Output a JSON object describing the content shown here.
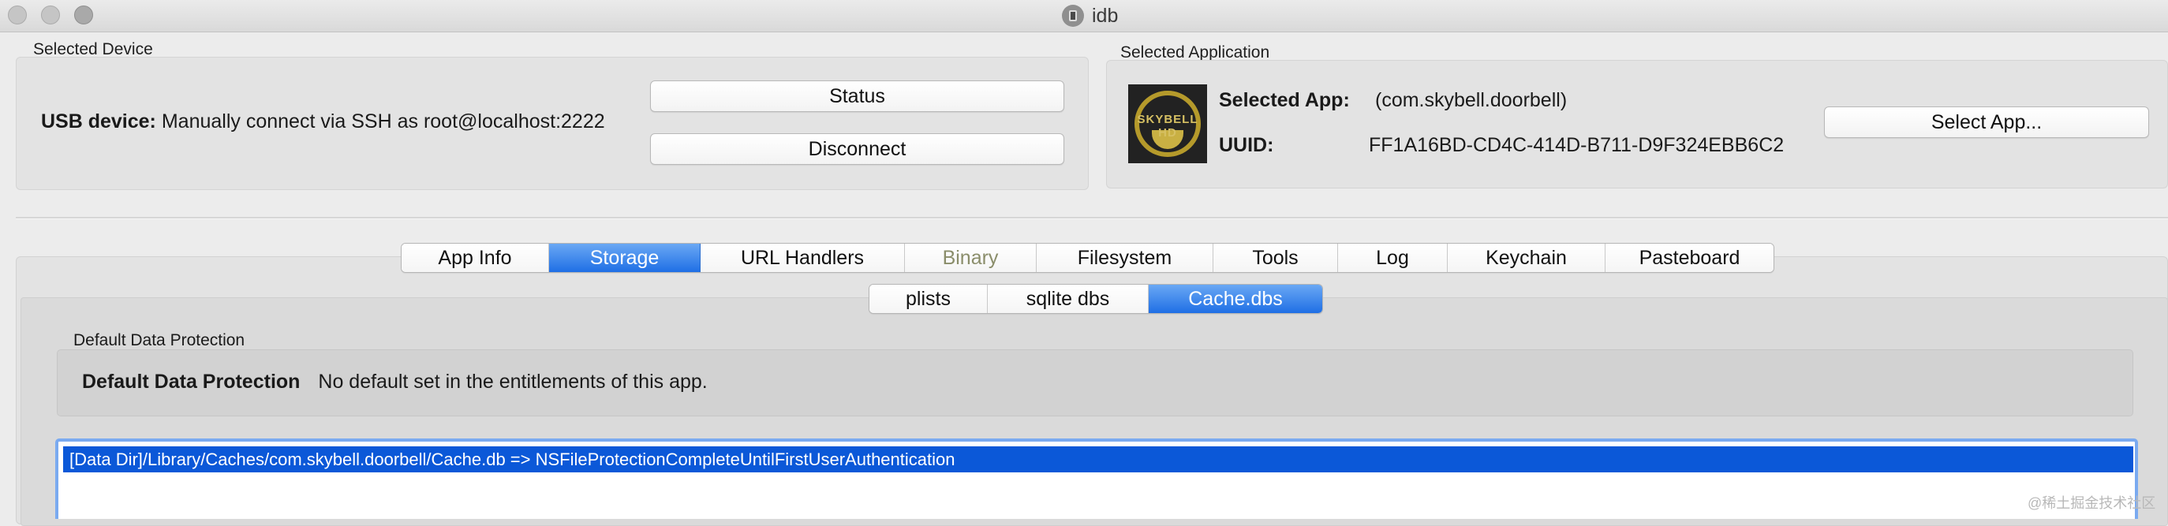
{
  "window": {
    "title": "idb",
    "icon": "idb-app-icon"
  },
  "device": {
    "group_label": "Selected Device",
    "usb_label": "USB device:",
    "usb_value": "Manually connect via SSH as root@localhost:2222",
    "status_button": "Status",
    "disconnect_button": "Disconnect"
  },
  "application": {
    "group_label": "Selected Application",
    "icon_text": "SKYBELL HD",
    "selected_app_label": "Selected App:",
    "selected_app_value": "(com.skybell.doorbell)",
    "uuid_label": "UUID:",
    "uuid_value": "FF1A16BD-CD4C-414D-B711-D9F324EBB6C2",
    "select_app_button": "Select App..."
  },
  "main_tabs": [
    {
      "label": "App Info",
      "selected": false,
      "enabled": true
    },
    {
      "label": "Storage",
      "selected": true,
      "enabled": true
    },
    {
      "label": "URL Handlers",
      "selected": false,
      "enabled": true
    },
    {
      "label": "Binary",
      "selected": false,
      "enabled": false
    },
    {
      "label": "Filesystem",
      "selected": false,
      "enabled": true
    },
    {
      "label": "Tools",
      "selected": false,
      "enabled": true
    },
    {
      "label": "Log",
      "selected": false,
      "enabled": true
    },
    {
      "label": "Keychain",
      "selected": false,
      "enabled": true
    },
    {
      "label": "Pasteboard",
      "selected": false,
      "enabled": true
    }
  ],
  "storage_tabs": [
    {
      "label": "plists",
      "selected": false
    },
    {
      "label": "sqlite dbs",
      "selected": false
    },
    {
      "label": "Cache.dbs",
      "selected": true
    }
  ],
  "data_protection": {
    "group_label": "Default Data Protection",
    "label": "Default Data Protection",
    "value": "No default set in the entitlements of this app."
  },
  "cache_files": [
    "[Data Dir]/Library/Caches/com.skybell.doorbell/Cache.db => NSFileProtectionCompleteUntilFirstUserAuthentication"
  ],
  "watermark": "@稀土掘金技术社区",
  "colors": {
    "selection_blue": "#0b58d8",
    "segment_selected": "#1f6fe5",
    "window_bg": "#ececec"
  }
}
